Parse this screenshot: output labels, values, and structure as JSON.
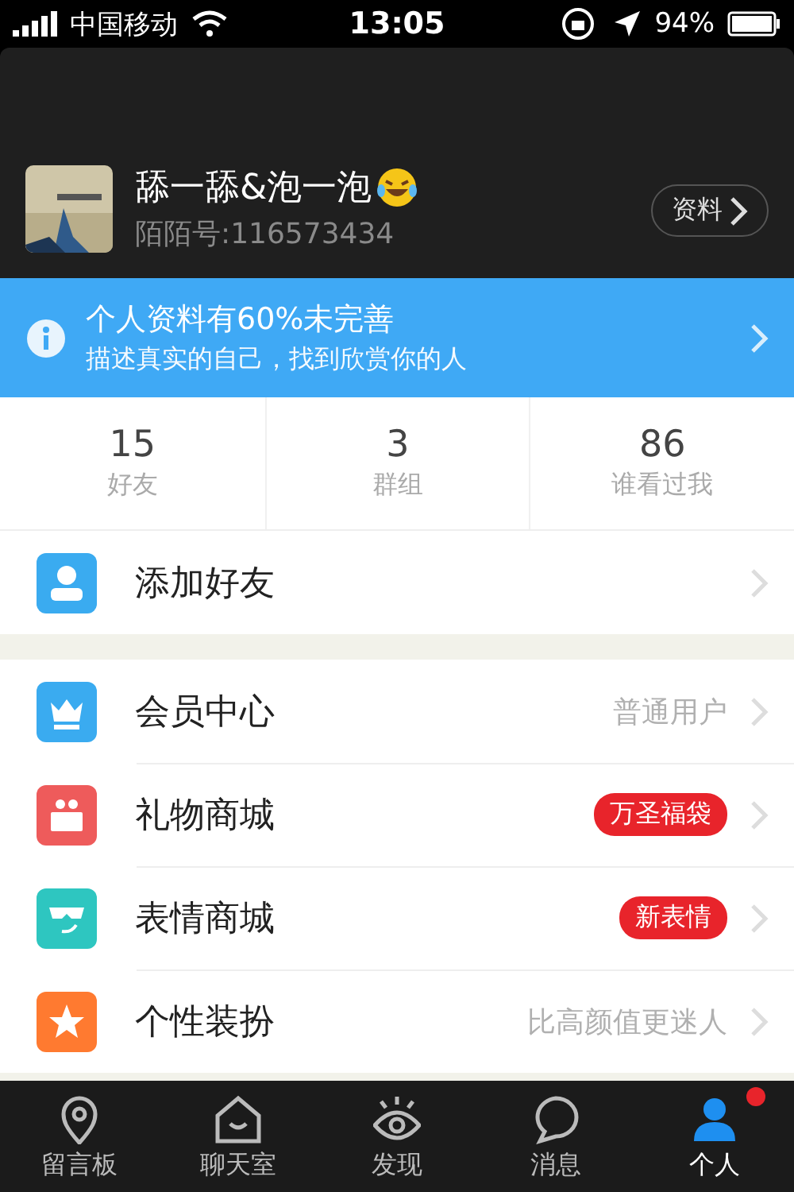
{
  "status_bar": {
    "carrier": "中国移动",
    "time": "13:05",
    "battery": "94%"
  },
  "profile": {
    "name": "舔一舔&泡一泡",
    "id": "陌陌号:116573434",
    "button": "资料"
  },
  "banner": {
    "title": "个人资料有60%未完善",
    "subtitle": "描述真实的自己，找到欣赏你的人"
  },
  "stats": [
    {
      "value": "15",
      "label": "好友"
    },
    {
      "value": "3",
      "label": "群组"
    },
    {
      "value": "86",
      "label": "谁看过我"
    }
  ],
  "groups": [
    [
      {
        "kind": "user",
        "label": "添加好友",
        "color": "#3aabf0"
      }
    ],
    [
      {
        "kind": "crown",
        "label": "会员中心",
        "color": "#3aabf0",
        "note": "普通用户"
      },
      {
        "kind": "gift",
        "label": "礼物商城",
        "color": "#ee5b5b",
        "badge": "万圣福袋"
      },
      {
        "kind": "face",
        "label": "表情商城",
        "color": "#2ec6c0",
        "badge": "新表情"
      },
      {
        "kind": "star",
        "label": "个性装扮",
        "color": "#ff7a30",
        "note": "比高颜值更迷人"
      }
    ]
  ],
  "tabs": [
    {
      "kind": "pin",
      "label": "留言板",
      "selected": false,
      "dot": false
    },
    {
      "kind": "house",
      "label": "聊天室",
      "selected": false,
      "dot": false
    },
    {
      "kind": "eye",
      "label": "发现",
      "selected": false,
      "dot": false
    },
    {
      "kind": "bubble",
      "label": "消息",
      "selected": false,
      "dot": false
    },
    {
      "kind": "person",
      "label": "个人",
      "selected": true,
      "dot": true
    }
  ]
}
